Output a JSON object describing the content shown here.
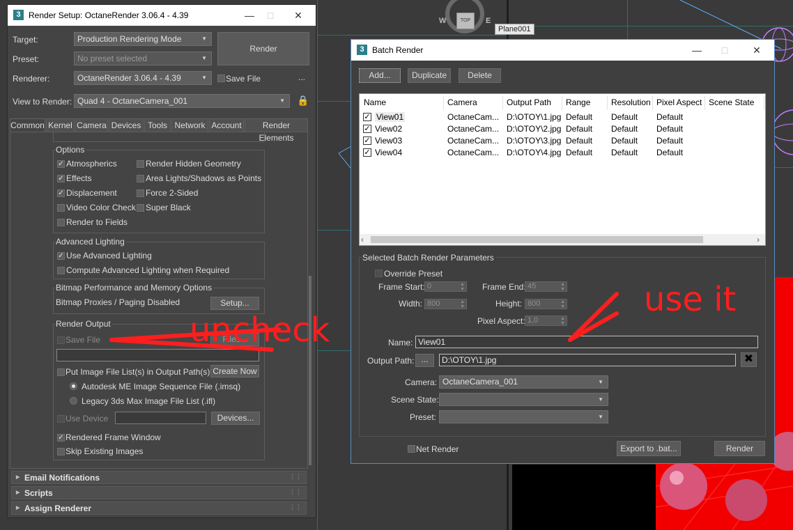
{
  "viewport": {
    "label_plane": "Plane001",
    "viewcube_top": "TOP",
    "compass_w": "W",
    "compass_e": "E"
  },
  "render_setup": {
    "title": "Render Setup: OctaneRender 3.06.4 - 4.39",
    "target_label": "Target:",
    "target_value": "Production Rendering Mode",
    "preset_label": "Preset:",
    "preset_value": "No preset selected",
    "renderer_label": "Renderer:",
    "renderer_value": "OctaneRender 3.06.4 - 4.39",
    "save_file_label": "Save File",
    "more_label": "...",
    "render_button": "Render",
    "view_label": "View to Render:",
    "view_value": "Quad 4 - OctaneCamera_001",
    "tabs": [
      "Common",
      "Kernel",
      "Camera",
      "Devices",
      "Tools",
      "Network",
      "Account",
      "Render Elements"
    ],
    "options_title": "Options",
    "options": [
      {
        "label": "Atmospherics",
        "checked": true
      },
      {
        "label": "Effects",
        "checked": true
      },
      {
        "label": "Displacement",
        "checked": true
      },
      {
        "label": "Video Color Check",
        "checked": false
      },
      {
        "label": "Render to Fields",
        "checked": false
      },
      {
        "label": "Render Hidden Geometry",
        "checked": false
      },
      {
        "label": "Area Lights/Shadows as Points",
        "checked": false
      },
      {
        "label": "Force 2-Sided",
        "checked": false
      },
      {
        "label": "Super Black",
        "checked": false
      }
    ],
    "adv_title": "Advanced Lighting",
    "adv_use": "Use Advanced Lighting",
    "adv_compute": "Compute Advanced Lighting when Required",
    "bitmap_title": "Bitmap Performance and Memory Options",
    "bitmap_text": "Bitmap Proxies / Paging Disabled",
    "setup_button": "Setup...",
    "output_title": "Render Output",
    "output_save": "Save File",
    "files_button": "Files...",
    "put_image": "Put Image File List(s) in Output Path(s)",
    "create_now": "Create Now",
    "radio_imsq": "Autodesk ME Image Sequence File (.imsq)",
    "radio_ifl": "Legacy 3ds Max Image File List (.ifl)",
    "use_device": "Use Device",
    "devices_button": "Devices...",
    "rendered_frame": "Rendered Frame Window",
    "skip_existing": "Skip Existing Images",
    "rollouts": [
      "Email Notifications",
      "Scripts",
      "Assign Renderer"
    ]
  },
  "batch": {
    "title": "Batch Render",
    "add": "Add...",
    "duplicate": "Duplicate",
    "delete": "Delete",
    "columns": [
      "Name",
      "Camera",
      "Output Path",
      "Range",
      "Resolution",
      "Pixel Aspect",
      "Scene State"
    ],
    "rows": [
      {
        "name": "View01",
        "camera": "OctaneCam...",
        "path": "D:\\OTOY\\1.jpg",
        "range": "Default",
        "res": "Default",
        "aspect": "Default"
      },
      {
        "name": "View02",
        "camera": "OctaneCam...",
        "path": "D:\\OTOY\\2.jpg",
        "range": "Default",
        "res": "Default",
        "aspect": "Default"
      },
      {
        "name": "View03",
        "camera": "OctaneCam...",
        "path": "D:\\OTOY\\3.jpg",
        "range": "Default",
        "res": "Default",
        "aspect": "Default"
      },
      {
        "name": "View04",
        "camera": "OctaneCam...",
        "path": "D:\\OTOY\\4.jpg",
        "range": "Default",
        "res": "Default",
        "aspect": "Default"
      }
    ],
    "params_title": "Selected Batch Render Parameters",
    "override_preset": "Override Preset",
    "frame_start_label": "Frame Start:",
    "frame_start": "0",
    "frame_end_label": "Frame End:",
    "frame_end": "45",
    "width_label": "Width:",
    "width": "800",
    "height_label": "Height:",
    "height": "800",
    "pixel_aspect_label": "Pixel Aspect:",
    "pixel_aspect": "1,0",
    "name_label": "Name:",
    "name_value": "View01",
    "output_label": "Output Path:",
    "browse": "...",
    "output_value": "D:\\OTOY\\1.jpg",
    "camera_label": "Camera:",
    "camera_value": "OctaneCamera_001",
    "scene_state_label": "Scene State:",
    "preset_label": "Preset:",
    "net_render": "Net Render",
    "export": "Export to .bat...",
    "render": "Render"
  },
  "annotations": {
    "uncheck": "uncheck",
    "use_it": "use it"
  }
}
